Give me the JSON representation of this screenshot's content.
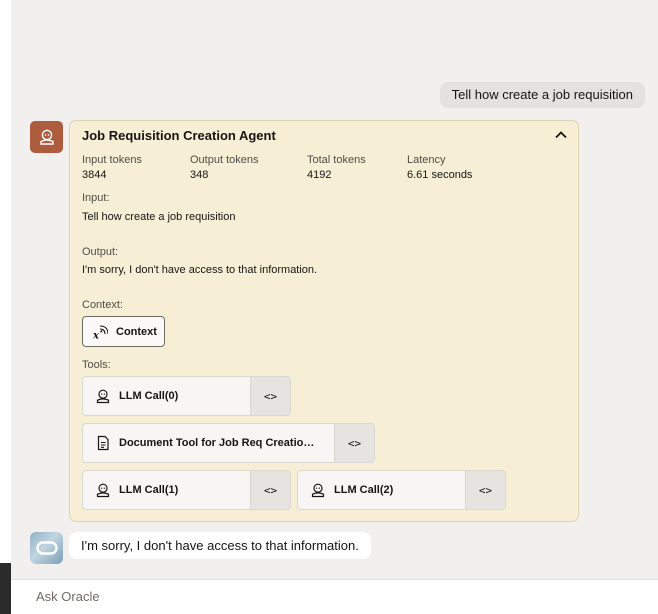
{
  "conversation": {
    "user_message": "Tell how create a job requisition",
    "bot_reply": "I'm sorry, I don't have access to that information."
  },
  "agent_card": {
    "title": "Job Requisition Creation Agent",
    "metrics": [
      {
        "label": "Input tokens",
        "value": "3844"
      },
      {
        "label": "Output tokens",
        "value": "348"
      },
      {
        "label": "Total tokens",
        "value": "4192"
      },
      {
        "label": "Latency",
        "value": "6.61 seconds"
      }
    ],
    "input_label": "Input:",
    "input_text": "Tell how create a job requisition",
    "output_label": "Output:",
    "output_text": "I'm sorry, I don't have access to that information.",
    "context_label": "Context:",
    "context_button": "Context",
    "tools_label": "Tools:",
    "tools": [
      {
        "label": "LLM Call(0)",
        "icon": "robot-icon",
        "code": "<>"
      },
      {
        "label": "Document Tool for Job Req Creation Agent",
        "icon": "document-icon",
        "code": "<>"
      },
      {
        "label": "LLM Call(1)",
        "icon": "robot-icon",
        "code": "<>"
      },
      {
        "label": "LLM Call(2)",
        "icon": "robot-icon",
        "code": "<>"
      }
    ]
  },
  "ask_bar": {
    "placeholder": "Ask Oracle"
  },
  "colors": {
    "card_bg": "#f6efd6",
    "agent_avatar": "#ad5c3d",
    "page_bg": "#f1f0ee"
  }
}
